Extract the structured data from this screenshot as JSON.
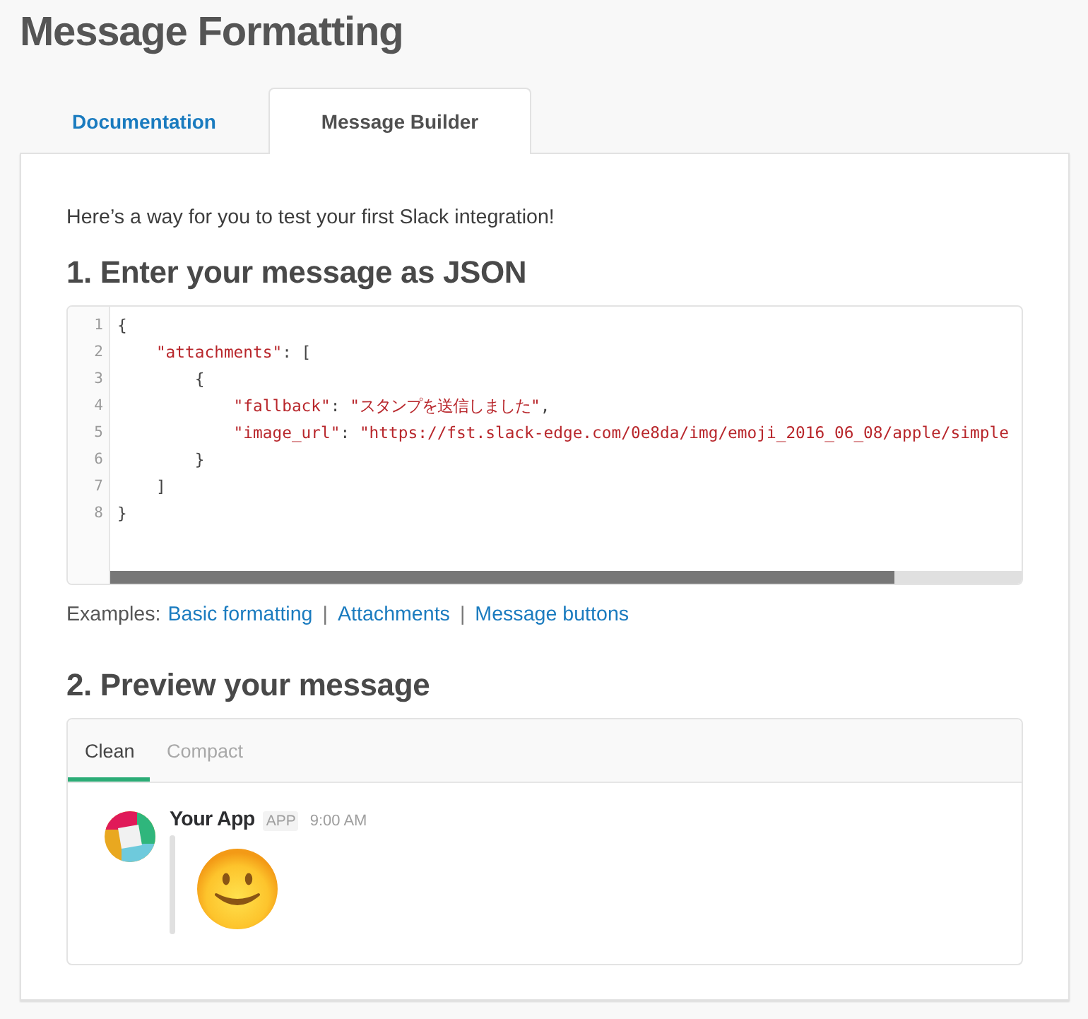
{
  "page": {
    "title": "Message Formatting"
  },
  "tabs": [
    {
      "label": "Documentation",
      "selected": false
    },
    {
      "label": "Message Builder",
      "selected": true
    }
  ],
  "builder": {
    "intro": "Here’s a way for you to test your first Slack integration!",
    "step1_heading": "1. Enter your message as JSON",
    "editor": {
      "lines": [
        {
          "number": "1",
          "tokens": [
            {
              "kind": "punct",
              "text": "{"
            }
          ]
        },
        {
          "number": "2",
          "tokens": [
            {
              "kind": "string",
              "text": "    \"attachments\""
            },
            {
              "kind": "punct",
              "text": ": ["
            }
          ]
        },
        {
          "number": "3",
          "tokens": [
            {
              "kind": "punct",
              "text": "        {"
            }
          ]
        },
        {
          "number": "4",
          "tokens": [
            {
              "kind": "string",
              "text": "            \"fallback\""
            },
            {
              "kind": "punct",
              "text": ": "
            },
            {
              "kind": "string",
              "text": "\"スタンプを送信しました\""
            },
            {
              "kind": "punct",
              "text": ","
            }
          ]
        },
        {
          "number": "5",
          "tokens": [
            {
              "kind": "string",
              "text": "            \"image_url\""
            },
            {
              "kind": "punct",
              "text": ": "
            },
            {
              "kind": "string",
              "text": "\"https://fst.slack-edge.com/0e8da/img/emoji_2016_06_08/apple/simple"
            }
          ]
        },
        {
          "number": "6",
          "tokens": [
            {
              "kind": "punct",
              "text": "        }"
            }
          ]
        },
        {
          "number": "7",
          "tokens": [
            {
              "kind": "punct",
              "text": "    ]"
            }
          ]
        },
        {
          "number": "8",
          "tokens": [
            {
              "kind": "punct",
              "text": "}"
            }
          ]
        }
      ]
    },
    "examples": {
      "label": "Examples:",
      "items": [
        {
          "kind": "link",
          "text": "Basic formatting"
        },
        {
          "kind": "separator",
          "text": "|"
        },
        {
          "kind": "link",
          "text": "Attachments"
        },
        {
          "kind": "separator",
          "text": "|"
        },
        {
          "kind": "link",
          "text": "Message buttons"
        }
      ]
    },
    "step2_heading": "2. Preview your message",
    "preview": {
      "tabs": [
        {
          "label": "Clean",
          "selected": true
        },
        {
          "label": "Compact",
          "selected": false
        }
      ],
      "message": {
        "sender": "Your App",
        "badge": "APP",
        "time": "9:00 AM"
      }
    }
  }
}
